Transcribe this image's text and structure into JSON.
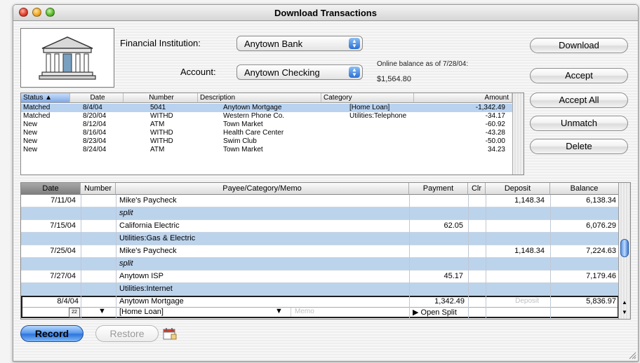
{
  "window": {
    "title": "Download Transactions"
  },
  "top": {
    "fi_label": "Financial Institution:",
    "fi_value": "Anytown Bank",
    "account_label": "Account:",
    "account_value": "Anytown Checking",
    "online_balance_label": "Online balance as of 7/28/04:",
    "online_balance_value": "$1,564.80"
  },
  "buttons": {
    "download": "Download",
    "accept": "Accept",
    "accept_all": "Accept All",
    "unmatch": "Unmatch",
    "delete": "Delete",
    "record": "Record",
    "restore": "Restore"
  },
  "downloads": {
    "headers": [
      "Status ▲",
      "Date",
      "Number",
      "Description",
      "Category",
      "Amount"
    ],
    "rows": [
      {
        "status": "Matched",
        "date": "8/4/04",
        "number": "5041",
        "description": "Anytown Mortgage",
        "category": "[Home Loan]",
        "amount": "-1,342.49"
      },
      {
        "status": "Matched",
        "date": "8/20/04",
        "number": "WITHD",
        "description": "Western Phone Co.",
        "category": "Utilities:Telephone",
        "amount": "-34.17"
      },
      {
        "status": "New",
        "date": "8/12/04",
        "number": "ATM",
        "description": "Town Market",
        "category": "",
        "amount": "-60.92"
      },
      {
        "status": "New",
        "date": "8/16/04",
        "number": "WITHD",
        "description": "Health Care Center",
        "category": "",
        "amount": "-43.28"
      },
      {
        "status": "New",
        "date": "8/23/04",
        "number": "WITHD",
        "description": "Swim Club",
        "category": "",
        "amount": "-50.00"
      },
      {
        "status": "New",
        "date": "8/24/04",
        "number": "ATM",
        "description": "Town Market",
        "category": "",
        "amount": "34.23"
      }
    ]
  },
  "register": {
    "headers": [
      "Date",
      "Number",
      "Payee/Category/Memo",
      "Payment",
      "Clr",
      "Deposit",
      "Balance"
    ],
    "rows": [
      {
        "date": "7/11/04",
        "payee": "Mike's Paycheck",
        "category": "split",
        "payment": "",
        "deposit": "1,148.34",
        "balance": "6,138.34"
      },
      {
        "date": "7/15/04",
        "payee": "California Electric",
        "category": "Utilities:Gas & Electric",
        "payment": "62.05",
        "deposit": "",
        "balance": "6,076.29"
      },
      {
        "date": "7/25/04",
        "payee": "Mike's Paycheck",
        "category": "split",
        "payment": "",
        "deposit": "1,148.34",
        "balance": "7,224.63"
      },
      {
        "date": "7/27/04",
        "payee": "Anytown ISP",
        "category": "Utilities:Internet",
        "payment": "45.17",
        "deposit": "",
        "balance": "7,179.46"
      }
    ],
    "edit": {
      "date": "8/4/04",
      "payee": "Anytown Mortgage",
      "payment": "1,342.49",
      "deposit_placeholder": "Deposit",
      "balance": "5,836.97",
      "calendar_day": "22",
      "category": "[Home Loan]",
      "memo_placeholder": "Memo",
      "open_split": "▶ Open Split"
    }
  }
}
